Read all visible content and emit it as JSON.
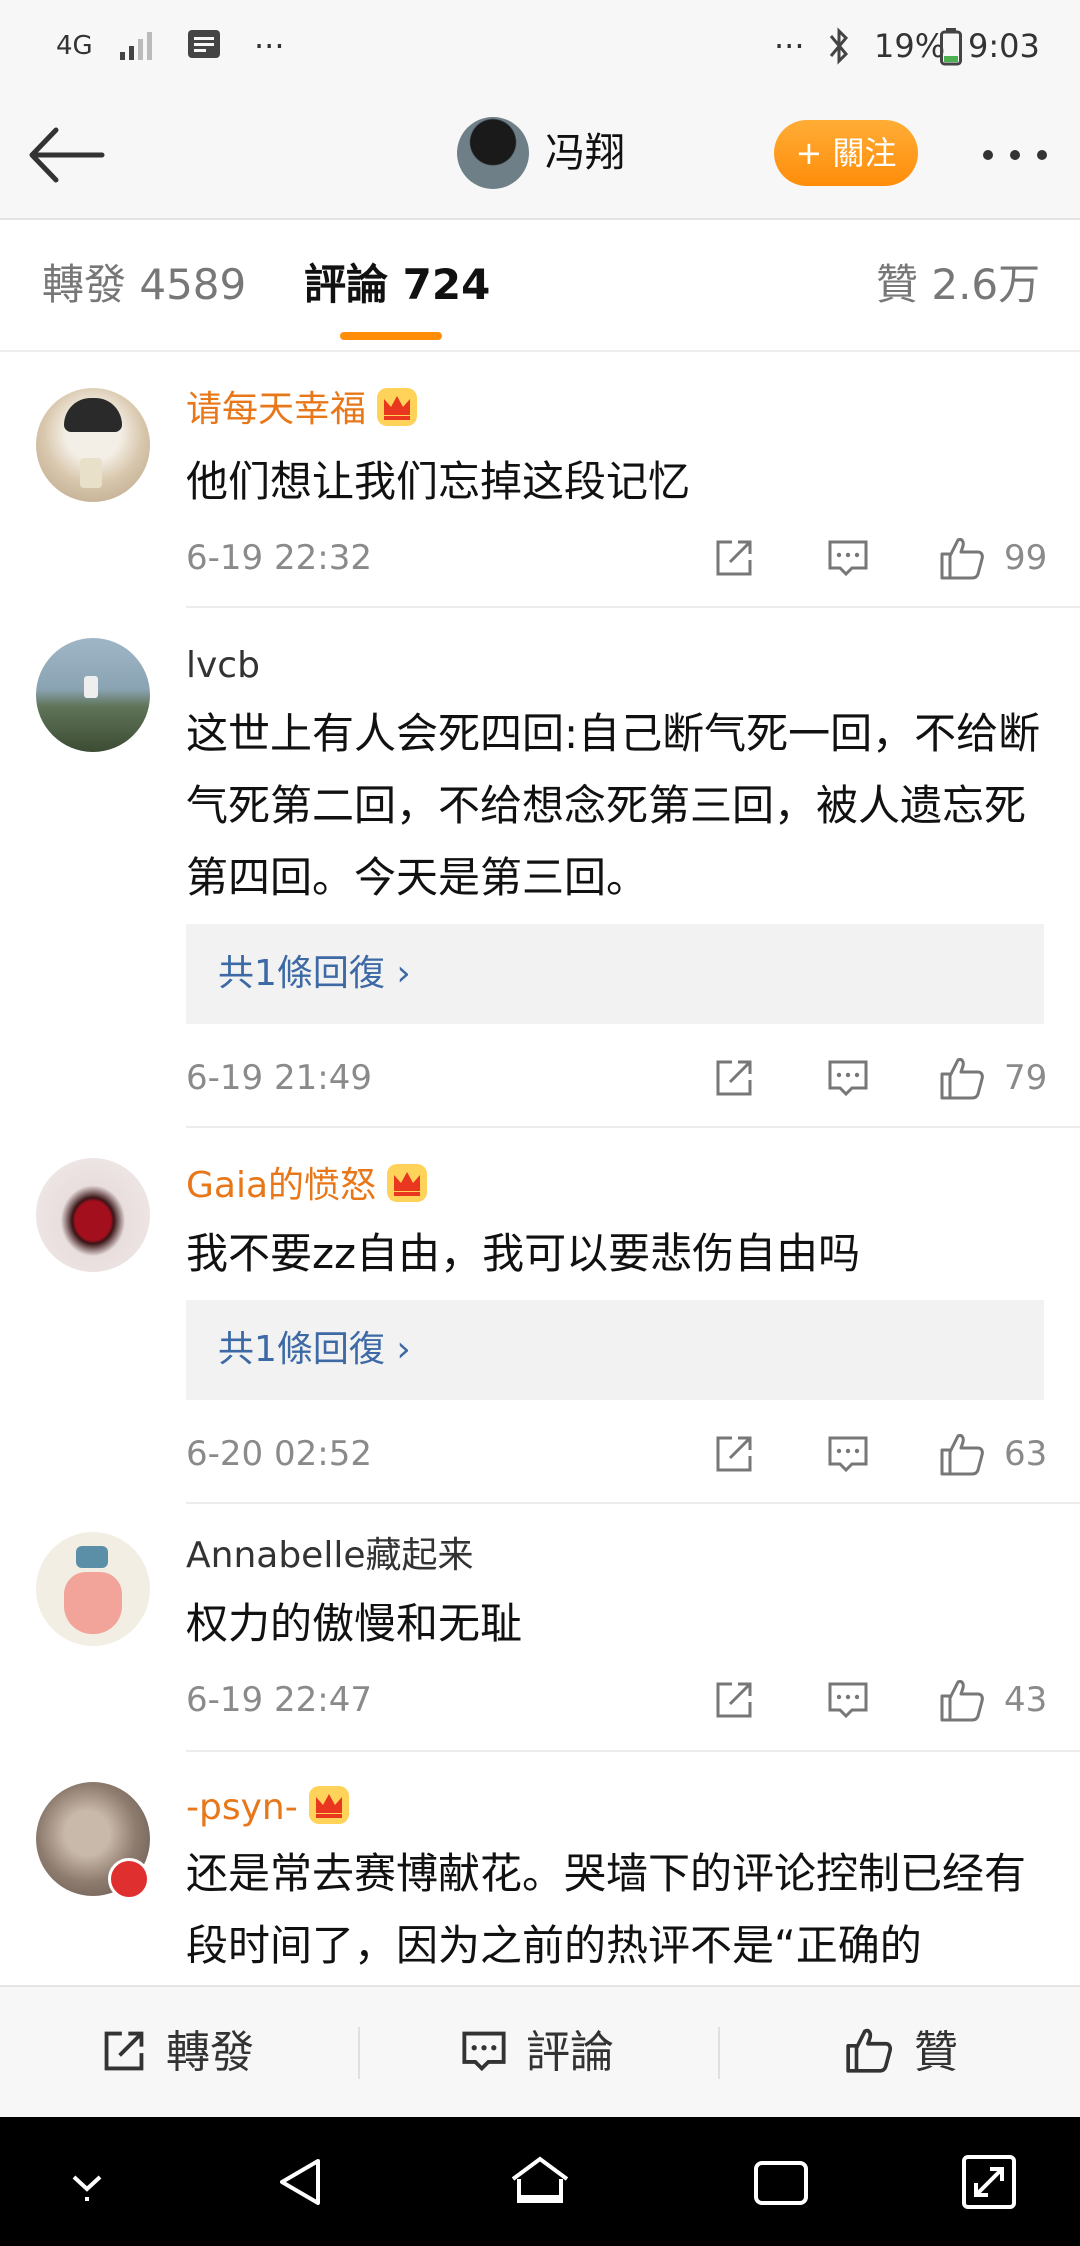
{
  "status_bar": {
    "network": "4G",
    "dots_left": "···",
    "dots_right": "···",
    "battery": "19%",
    "time": "9:03"
  },
  "header": {
    "author": "冯翔",
    "follow_label": "+ 關注"
  },
  "tabs": {
    "repost": "轉發 4589",
    "comments": "評論 724",
    "likes": "贊 2.6万"
  },
  "comments": [
    {
      "name": "请每天幸福",
      "vip": true,
      "text": "他们想让我们忘掉这段记忆",
      "time": "6-19 22:32",
      "likes": "99"
    },
    {
      "name": "lvcb",
      "vip": false,
      "text": "这世上有人会死四回:自己断气死一回，不给断气死第二回，不给想念死第三回，被人遗忘死第四回。今天是第三回。",
      "reply": "共1條回復 ›",
      "time": "6-19 21:49",
      "likes": "79"
    },
    {
      "name": "Gaia的愤怒",
      "vip": true,
      "text": "我不要zz自由，我可以要悲伤自由吗",
      "reply": "共1條回復 ›",
      "time": "6-20 02:52",
      "likes": "63"
    },
    {
      "name": "Annabelle藏起来",
      "vip": false,
      "text": "权力的傲慢和无耻",
      "time": "6-19 22:47",
      "likes": "43"
    },
    {
      "name": "-psyn-",
      "vip": true,
      "text": "还是常去赛博献花。哭墙下的评论控制已经有段时间了，因为之前的热评不是“正确的"
    }
  ],
  "bottom_bar": {
    "repost": "轉發",
    "comment": "評論",
    "like": "贊"
  },
  "colors": {
    "accent": "#ff8d0a",
    "vip_name": "#e8771a",
    "link": "#3d6aa5"
  }
}
